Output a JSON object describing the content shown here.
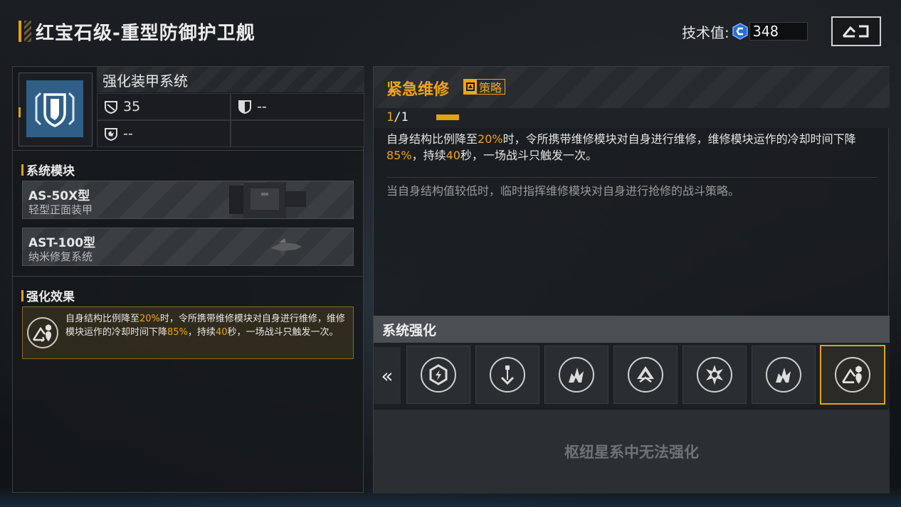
{
  "header": {
    "title": "红宝石级-重型防御护卫舰",
    "tech_label": "技术值:",
    "tech_value": "348",
    "back_icon": "return-icon"
  },
  "system": {
    "name": "强化装甲系统",
    "icon": "armor-shield-icon",
    "stats": [
      {
        "icon": "structure-stat-icon",
        "value": "35"
      },
      {
        "icon": "armor-stat-icon",
        "value": "--"
      },
      {
        "icon": "shield-stat-icon",
        "value": "--"
      }
    ]
  },
  "modules": {
    "title": "系统模块",
    "items": [
      {
        "name": "AS-50X型",
        "subtitle": "轻型正面装甲"
      },
      {
        "name": "AST-100型",
        "subtitle": "纳米修复系统"
      }
    ]
  },
  "effect": {
    "title": "强化效果",
    "icon": "repair-drone-icon",
    "text_1": "自身结构比例降至",
    "val_1": "20%",
    "text_2": "时，令所携带维修模块对自身进行维修，维修模块运作的冷却时间下降",
    "val_2": "85%",
    "text_3": "，持续",
    "val_3": "40",
    "text_4": "秒，一场战斗只触发一次。"
  },
  "skill": {
    "title": "紧急维修",
    "tag": "策略",
    "level_current": "1",
    "level_max": "/1",
    "desc_1": "自身结构比例降至",
    "val_1": "20%",
    "desc_2": "时，令所携带维修模块对自身进行维修，维修模块运作的冷却时间下降",
    "val_2": "85%",
    "desc_3": "，持续",
    "val_3": "40",
    "desc_4": "秒，一场战斗只触发一次。",
    "flavor": "当自身结构值较低时，临时指挥维修模块对自身进行抢修的战斗策略。"
  },
  "enhance": {
    "title": "系统强化",
    "scroll_left": "«",
    "slots": [
      {
        "icon": "hex-lightning-icon"
      },
      {
        "icon": "drill-down-icon"
      },
      {
        "icon": "burst-damage-icon"
      },
      {
        "icon": "delta-boost-icon"
      },
      {
        "icon": "star-burst-icon"
      },
      {
        "icon": "burst-damage-icon"
      },
      {
        "icon": "repair-drone-icon",
        "selected": true
      }
    ],
    "locked_text": "枢纽星系中无法强化"
  },
  "colors": {
    "accent": "#e0a21a",
    "highlight": "#f0a51c",
    "system_icon_bg": "#2f5f86"
  }
}
